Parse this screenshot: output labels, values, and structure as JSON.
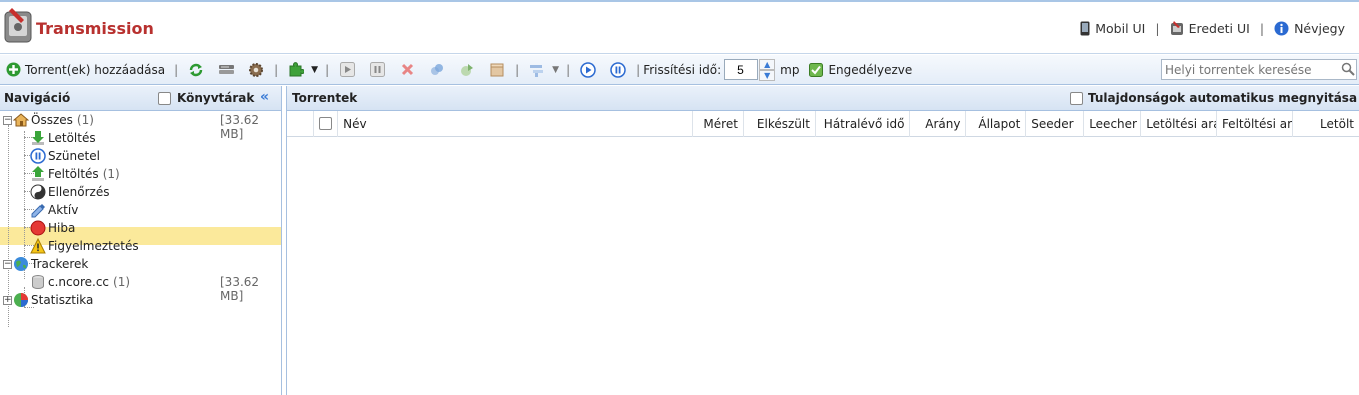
{
  "header": {
    "title": "Transmission",
    "links": [
      {
        "label": "Mobil UI"
      },
      {
        "label": "Eredeti UI"
      },
      {
        "label": "Névjegy"
      }
    ]
  },
  "toolbar": {
    "add_label": "Torrent(ek) hozzáadása",
    "refresh_label": "Frissítési idő:",
    "refresh_value": "5",
    "refresh_unit": "mp",
    "enabled_label": "Engedélyezve",
    "search_placeholder": "Helyi torrentek keresése"
  },
  "nav": {
    "title": "Navigáció",
    "libraries_label": "Könyvtárak",
    "items": [
      {
        "label": "Összes",
        "count": "(1)",
        "size": "[33.62 MB]"
      },
      {
        "label": "Letöltés"
      },
      {
        "label": "Szünetel"
      },
      {
        "label": "Feltöltés",
        "count": "(1)"
      },
      {
        "label": "Ellenőrzés"
      },
      {
        "label": "Aktív"
      },
      {
        "label": "Hiba"
      },
      {
        "label": "Figyelmeztetés"
      },
      {
        "label": "Trackerek"
      },
      {
        "label": "c.ncore.cc",
        "count": "(1)",
        "size": "[33.62 MB]"
      },
      {
        "label": "Statisztika"
      }
    ]
  },
  "torrents": {
    "title": "Torrentek",
    "auto_open_label": "Tulajdonságok automatikus megnyitása",
    "columns": [
      "Név",
      "Méret",
      "Elkészült",
      "Hátralévő idő",
      "Arány",
      "Állapot",
      "Seeder",
      "Leecher",
      "Letöltési arán",
      "Feltöltési arár",
      "Letölt"
    ]
  },
  "colors": {
    "title_red": "#b8312f",
    "selection": "#fbe99b",
    "border_blue": "#a6c0e0"
  }
}
